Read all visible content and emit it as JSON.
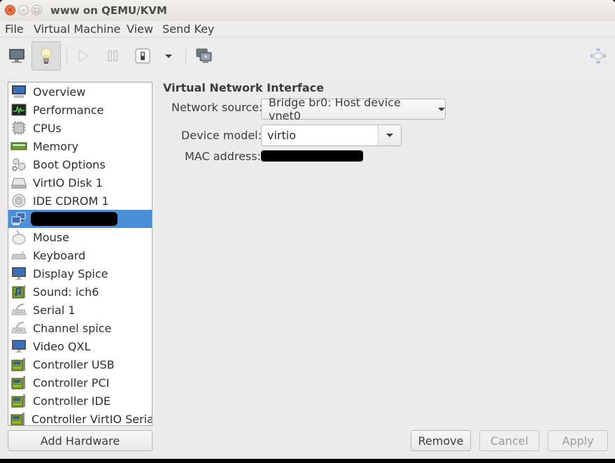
{
  "window": {
    "title": "www on QEMU/KVM",
    "close_symbol": "×",
    "min_symbol": "–",
    "max_symbol": "□"
  },
  "menubar": {
    "items": [
      "File",
      "Virtual Machine",
      "View",
      "Send Key"
    ]
  },
  "toolbar": {
    "buttons": [
      {
        "name": "console-view",
        "icon": "monitor-icon",
        "active": false
      },
      {
        "name": "details-view",
        "icon": "lightbulb-icon",
        "active": true
      },
      {
        "name": "run",
        "icon": "play-icon",
        "enabled": false
      },
      {
        "name": "pause",
        "icon": "pause-icon",
        "enabled": false
      },
      {
        "name": "shutdown",
        "icon": "power-switch-icon"
      },
      {
        "name": "shutdown-menu",
        "icon": "chevron-down-icon"
      },
      {
        "name": "snapshots",
        "icon": "snapshots-icon"
      },
      {
        "name": "fullscreen",
        "icon": "resize-arrows-icon",
        "enabled": false
      }
    ]
  },
  "sidebar": {
    "items": [
      {
        "label": "Overview",
        "icon": "monitor-icon"
      },
      {
        "label": "Performance",
        "icon": "performance-graph-icon"
      },
      {
        "label": "CPUs",
        "icon": "cpu-chip-icon"
      },
      {
        "label": "Memory",
        "icon": "memory-module-icon"
      },
      {
        "label": "Boot Options",
        "icon": "gears-icon"
      },
      {
        "label": "VirtIO Disk 1",
        "icon": "hard-disk-icon"
      },
      {
        "label": "IDE CDROM 1",
        "icon": "cdrom-icon"
      },
      {
        "label": "",
        "icon": "network-icon",
        "selected": true,
        "redacted": true
      },
      {
        "label": "Mouse",
        "icon": "mouse-icon"
      },
      {
        "label": "Keyboard",
        "icon": "keyboard-icon"
      },
      {
        "label": "Display Spice",
        "icon": "display-icon"
      },
      {
        "label": "Sound: ich6",
        "icon": "sound-card-icon"
      },
      {
        "label": "Serial 1",
        "icon": "serial-port-icon"
      },
      {
        "label": "Channel spice",
        "icon": "serial-port-icon"
      },
      {
        "label": "Video QXL",
        "icon": "display-icon"
      },
      {
        "label": "Controller USB",
        "icon": "controller-card-icon"
      },
      {
        "label": "Controller PCI",
        "icon": "controller-card-icon"
      },
      {
        "label": "Controller IDE",
        "icon": "controller-card-icon"
      },
      {
        "label": "Controller VirtIO Serial",
        "icon": "controller-card-icon"
      }
    ],
    "add_hardware_label": "Add Hardware"
  },
  "details": {
    "section_title": "Virtual Network Interface",
    "network_source_label": "Network source:",
    "network_source_value": "Bridge br0: Host device vnet0",
    "device_model_label": "Device model:",
    "device_model_value": "virtio",
    "mac_address_label": "MAC address:",
    "mac_address_value": ""
  },
  "footer": {
    "remove_label": "Remove",
    "cancel_label": "Cancel",
    "apply_label": "Apply"
  },
  "colors": {
    "selection": "#4a90d9",
    "close_button": "#e8673f"
  }
}
